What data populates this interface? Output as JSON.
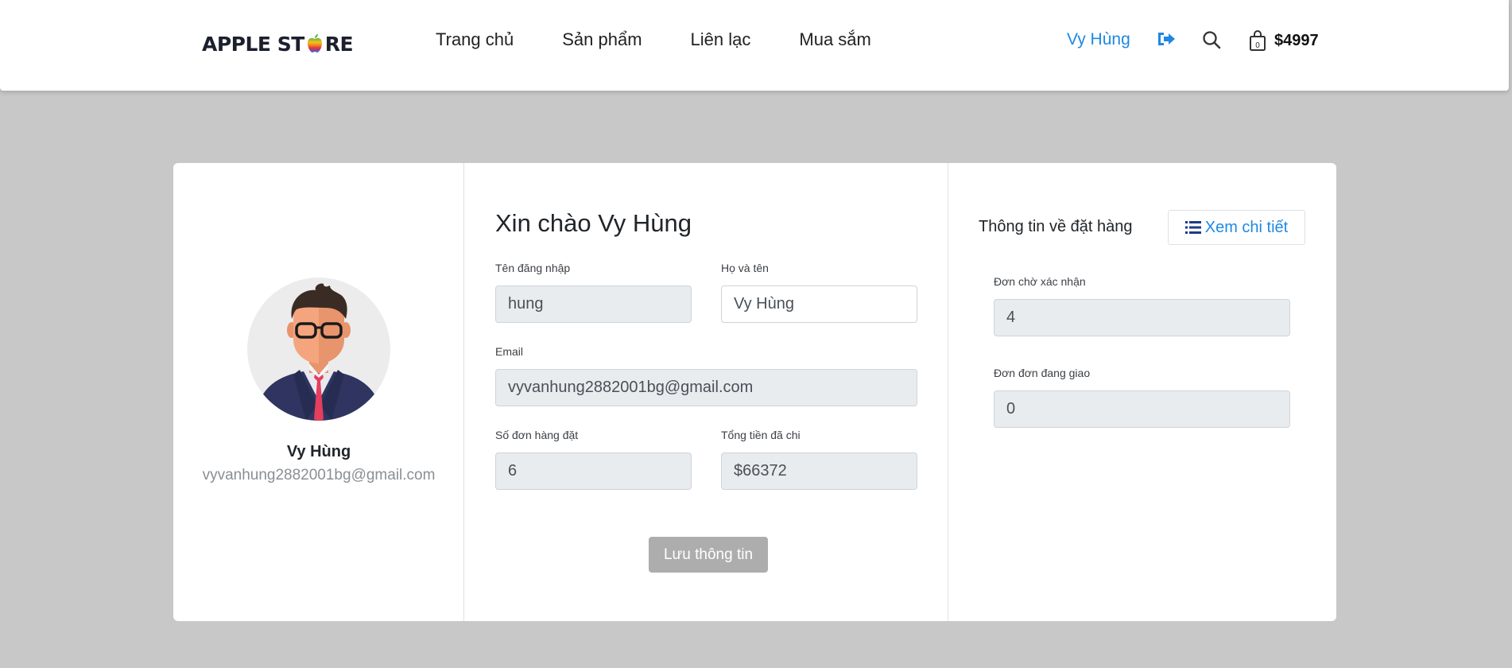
{
  "header": {
    "logo_text_left": "APPLE ST",
    "logo_text_right": "RE",
    "nav": [
      "Trang chủ",
      "Sản phẩm",
      "Liên lạc",
      "Mua sắm"
    ],
    "user_name": "Vy Hùng",
    "cart_count": "0",
    "cart_total": "$4997",
    "icons": [
      "logout-icon",
      "search-icon",
      "shopping-bag-icon"
    ]
  },
  "profile": {
    "name": "Vy Hùng",
    "email": "vyvanhung2882001bg@gmail.com"
  },
  "form": {
    "greeting": "Xin chào Vy Hùng",
    "username_label": "Tên đăng nhập",
    "username_value": "hung",
    "fullname_label": "Họ và tên",
    "fullname_value": "Vy Hùng",
    "email_label": "Email",
    "email_value": "vyvanhung2882001bg@gmail.com",
    "orders_label": "Số đơn hàng đặt",
    "orders_value": "6",
    "spent_label": "Tổng tiền đã chi",
    "spent_value": "$66372",
    "save_label": "Lưu thông tin"
  },
  "orders": {
    "title": "Thông tin về đặt hàng",
    "detail_label": "Xem chi tiết",
    "pending_label": "Đơn chờ xác nhận",
    "pending_value": "4",
    "shipping_label": "Đơn đơn đang giao",
    "shipping_value": "0"
  },
  "colors": {
    "accent": "#1e88e5",
    "page_bg": "#c8c8c8",
    "save_button": "#adadad"
  }
}
